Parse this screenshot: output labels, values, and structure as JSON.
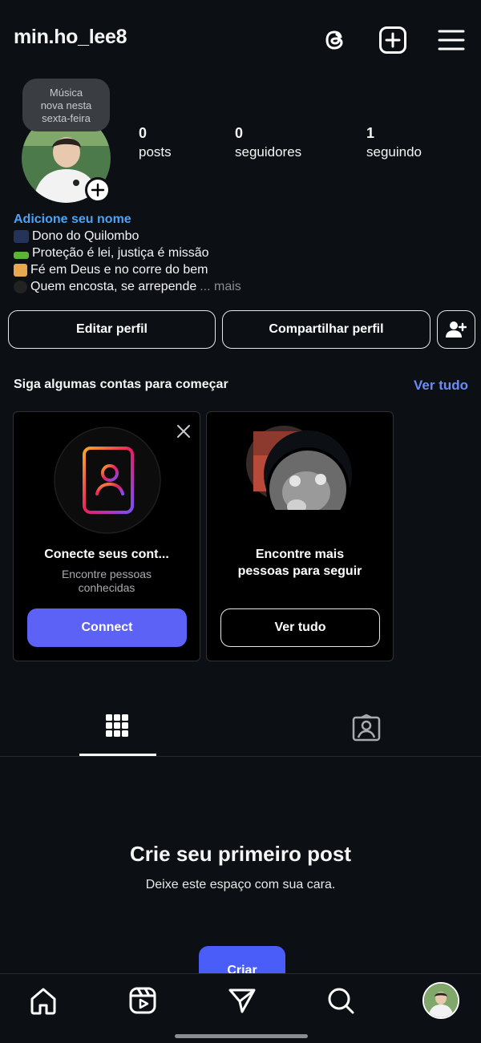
{
  "header": {
    "username": "min.ho_lee8",
    "icons": [
      "threads-icon",
      "plus-square-icon",
      "menu-icon"
    ]
  },
  "note": {
    "line1": "Música",
    "line2": "nova nesta",
    "line3": "sexta-feira"
  },
  "stats": [
    {
      "count": "0",
      "label": "posts"
    },
    {
      "count": "0",
      "label": "seguidores"
    },
    {
      "count": "1",
      "label": "seguindo"
    }
  ],
  "bio": {
    "name_prompt": "Adicione seu nome",
    "lines": [
      "Dono do Quilombo",
      "Proteção é lei, justiça é missão",
      "Fé em Deus e no corre do bem",
      "Quem encosta, se arrepende"
    ],
    "more": "... mais"
  },
  "actions": {
    "edit": "Editar perfil",
    "share": "Compartilhar perfil",
    "add_person_icon": "add-person-icon"
  },
  "suggestions": {
    "title": "Siga algumas contas para começar",
    "see_all": "Ver tudo",
    "cards": [
      {
        "title": "Conecte seus cont...",
        "sub1": "Encontre pessoas",
        "sub2": "conhecidas",
        "button": "Connect"
      },
      {
        "title1": "Encontre mais",
        "title2": "pessoas para seguir",
        "button": "Ver tudo"
      }
    ]
  },
  "tabs": [
    "grid-icon",
    "tagged-icon"
  ],
  "empty": {
    "title": "Crie seu primeiro post",
    "subtitle": "Deixe este espaço com sua cara.",
    "button": "Criar"
  },
  "nav": [
    "home-icon",
    "reels-icon",
    "send-icon",
    "search-icon",
    "profile-avatar"
  ],
  "colors": {
    "background": "#0c1014",
    "link_blue": "#4aa3f5",
    "accent": "#4a5df9",
    "see_all": "#6c8cf5"
  }
}
